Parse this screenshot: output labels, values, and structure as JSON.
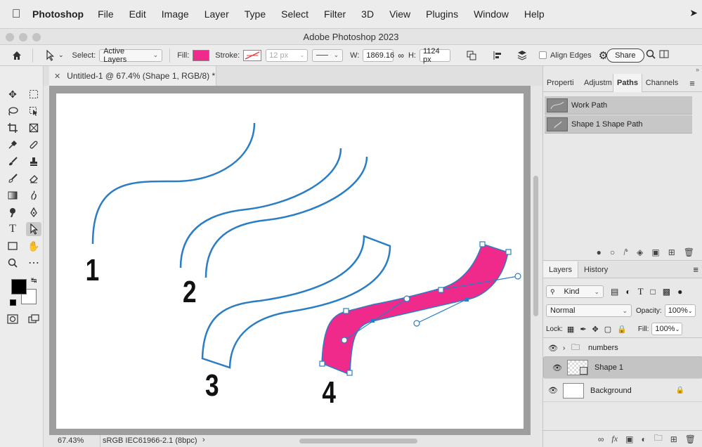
{
  "menubar": {
    "app": "Photoshop",
    "items": [
      "File",
      "Edit",
      "Image",
      "Layer",
      "Type",
      "Select",
      "Filter",
      "3D",
      "View",
      "Plugins",
      "Window",
      "Help"
    ]
  },
  "window": {
    "title": "Adobe Photoshop 2023"
  },
  "options": {
    "select_label": "Select:",
    "select_value": "Active Layers",
    "fill_label": "Fill:",
    "fill_color": "#f02a8a",
    "stroke_label": "Stroke:",
    "stroke_width": "12 px",
    "w_label": "W:",
    "w_value": "1869.16",
    "h_label": "H:",
    "h_value": "1124 px",
    "align_edges_label": "Align Edges",
    "share_label": "Share"
  },
  "document": {
    "tab_title": "Untitled-1 @ 67.4% (Shape 1, RGB/8) *"
  },
  "status": {
    "zoom": "67.43%",
    "profile": "sRGB IEC61966-2.1 (8bpc)"
  },
  "canvas": {
    "labels": [
      "1",
      "2",
      "3",
      "4"
    ],
    "path_color": "#2b7dc4",
    "shape_fill": "#f02a8a"
  },
  "paths_panel": {
    "tabs": [
      "Properti",
      "Adjustm",
      "Paths",
      "Channels"
    ],
    "active_tab": "Paths",
    "items": [
      "Work Path",
      "Shape 1 Shape Path"
    ]
  },
  "layers_panel": {
    "tabs": [
      "Layers",
      "History"
    ],
    "kind_label": "Kind",
    "blend_mode": "Normal",
    "opacity_label": "Opacity:",
    "opacity_value": "100%",
    "lock_label": "Lock:",
    "fill_label": "Fill:",
    "fill_value": "100%",
    "layers": [
      "numbers",
      "Shape 1",
      "Background"
    ]
  }
}
